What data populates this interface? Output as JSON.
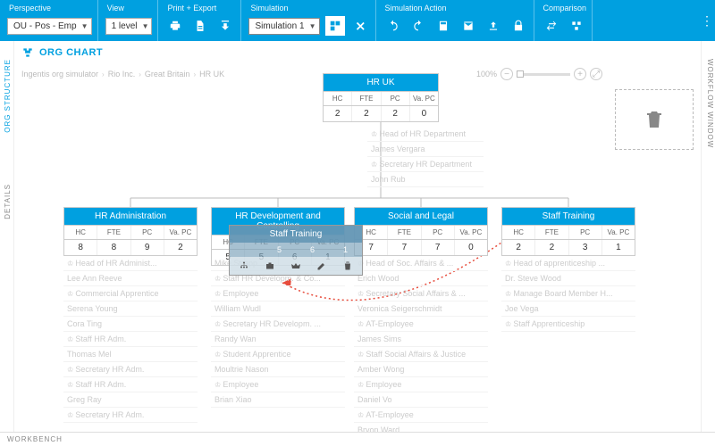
{
  "toolbar": {
    "groups": {
      "perspective": {
        "label": "Perspective",
        "value": "OU - Pos - Emp"
      },
      "view": {
        "label": "View",
        "value": "1 level"
      },
      "printExport": {
        "label": "Print + Export"
      },
      "simulation": {
        "label": "Simulation",
        "value": "Simulation 1"
      },
      "simulationAction": {
        "label": "Simulation Action"
      },
      "comparison": {
        "label": "Comparison"
      }
    }
  },
  "page": {
    "title": "ORG CHART",
    "tabs": {
      "orgStructure": "ORG STRUCTURE",
      "details": "DETAILS",
      "workflow": "WORKFLOW WINDOW",
      "workbench": "WORKBENCH"
    }
  },
  "breadcrumb": [
    "Ingentis org simulator",
    "Rio Inc.",
    "Great Britain",
    "HR UK"
  ],
  "zoom": {
    "percent": "100%"
  },
  "metricHeaders": [
    "HC",
    "FTE",
    "PC",
    "Va. PC"
  ],
  "root": {
    "title": "HR UK",
    "values": [
      "2",
      "2",
      "2",
      "0"
    ],
    "people": [
      {
        "role": "Head of HR Department",
        "name": "James Vergara"
      },
      {
        "role": "Secretary HR Department",
        "name": "John Rub"
      }
    ]
  },
  "children": [
    {
      "title": "HR Administration",
      "values": [
        "8",
        "8",
        "9",
        "2"
      ],
      "people": [
        {
          "role": "Head of HR Administ...",
          "name": "Lee Ann Reeve"
        },
        {
          "role": "Commercial Apprentice",
          "name": "Serena Young"
        },
        {
          "role": "",
          "name": "Cora Ting"
        },
        {
          "role": "Staff HR Adm.",
          "name": "Thomas Mel"
        },
        {
          "role": "Secretary HR Adm.",
          "name": ""
        },
        {
          "role": "Staff HR Adm.",
          "name": "Greg Ray"
        },
        {
          "role": "Secretary HR Adm.",
          "name": ""
        }
      ]
    },
    {
      "title": "HR Development and Controlling",
      "values": [
        "5",
        "5",
        "6",
        "1"
      ],
      "people": [
        {
          "role": "",
          "name": "Mike Strapp"
        },
        {
          "role": "Staff HR Developm. & Co...",
          "name": ""
        },
        {
          "role": "Employee",
          "name": "William Wudl"
        },
        {
          "role": "Secretary HR Developm. ...",
          "name": "Randy Wan"
        },
        {
          "role": "Student Apprentice",
          "name": "Moultrie Nason"
        },
        {
          "role": "Employee",
          "name": "Brian Xiao"
        }
      ]
    },
    {
      "title": "Social and Legal",
      "values": [
        "7",
        "7",
        "7",
        "0"
      ],
      "people": [
        {
          "role": "Head of Soc. Affairs & ...",
          "name": "Erich Wood"
        },
        {
          "role": "Secretary Social Affairs & ...",
          "name": "Veronica Seigerschmidt"
        },
        {
          "role": "AT-Employee",
          "name": "James Sims"
        },
        {
          "role": "Staff Social Affairs & Justice",
          "name": "Amber Wong"
        },
        {
          "role": "Employee",
          "name": "Daniel Vo"
        },
        {
          "role": "AT-Employee",
          "name": "Bryon Ward"
        }
      ]
    },
    {
      "title": "Staff Training",
      "values": [
        "2",
        "2",
        "3",
        "1"
      ],
      "people": [
        {
          "role": "Head of apprenticeship ...",
          "name": "Dr. Steve Wood"
        },
        {
          "role": "Manage Board Member H...",
          "name": "Joe Vega"
        },
        {
          "role": "Staff Apprenticeship",
          "name": ""
        }
      ]
    }
  ],
  "dragGhost": {
    "title": "Staff Training",
    "values": [
      "",
      "5",
      "6",
      "1"
    ]
  }
}
